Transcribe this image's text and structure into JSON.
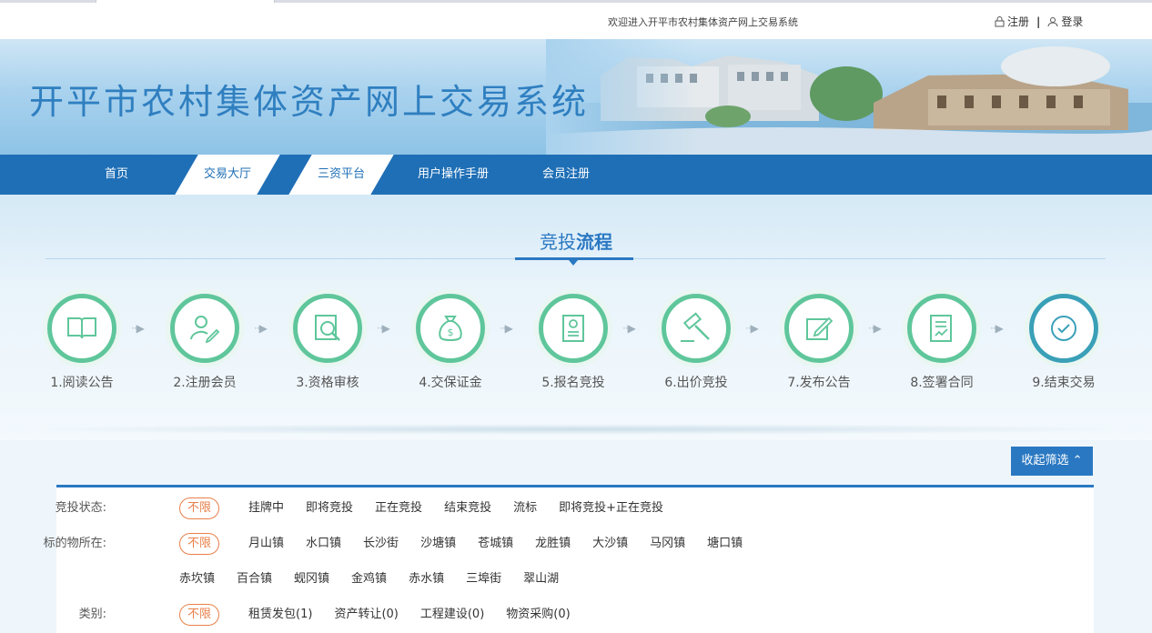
{
  "header": {
    "welcome": "欢迎进入开平市农村集体资产网上交易系统",
    "register": "注册",
    "separator": "|",
    "login": "登录"
  },
  "banner": {
    "title": "开平市农村集体资产网上交易系统"
  },
  "nav": {
    "items": [
      "首页",
      "交易大厅",
      "三资平台",
      "用户操作手册",
      "会员注册"
    ]
  },
  "process": {
    "heading_prefix": "竞投",
    "heading_bold": "流程",
    "steps": [
      {
        "label": "1.阅读公告",
        "icon": "book-icon"
      },
      {
        "label": "2.注册会员",
        "icon": "user-edit-icon"
      },
      {
        "label": "3.资格审核",
        "icon": "document-search-icon"
      },
      {
        "label": "4.交保证金",
        "icon": "money-bag-icon"
      },
      {
        "label": "5.报名竞投",
        "icon": "id-card-icon"
      },
      {
        "label": "6.出价竞投",
        "icon": "gavel-icon"
      },
      {
        "label": "7.发布公告",
        "icon": "edit-icon"
      },
      {
        "label": "8.签署合同",
        "icon": "contract-icon"
      },
      {
        "label": "9.结束交易",
        "icon": "check-circle-icon"
      }
    ]
  },
  "filters": {
    "toggle": "收起筛选 ⌃",
    "status": {
      "label": "竞投状态:",
      "options": [
        "不限",
        "挂牌中",
        "即将竞投",
        "正在竞投",
        "结束竞投",
        "流标",
        "即将竞投+正在竞投"
      ]
    },
    "location": {
      "label": "标的物所在:",
      "options_row1": [
        "不限",
        "月山镇",
        "水口镇",
        "长沙街",
        "沙塘镇",
        "苍城镇",
        "龙胜镇",
        "大沙镇",
        "马冈镇",
        "塘口镇"
      ],
      "options_row2": [
        "赤坎镇",
        "百合镇",
        "蚬冈镇",
        "金鸡镇",
        "赤水镇",
        "三埠街",
        "翠山湖"
      ]
    },
    "category": {
      "label": "类别:",
      "options": [
        "不限",
        "租赁发包(1)",
        "资产转让(0)",
        "工程建设(0)",
        "物资采购(0)"
      ]
    }
  },
  "colors": {
    "nav": "#1f6fb6",
    "accent": "#2a78c2",
    "ring": "#5fc69b",
    "active": "#e8804a"
  }
}
